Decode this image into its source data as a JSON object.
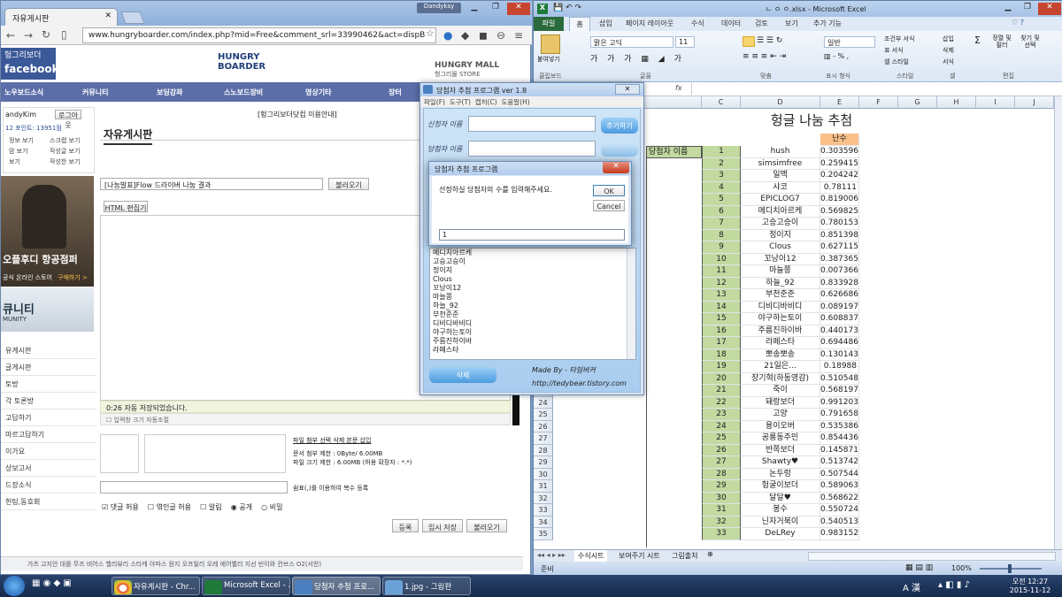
{
  "chrome": {
    "tab_title": "자유게시판",
    "user_badge": "Dandyksy",
    "url": "www.hungryboarder.com/index.php?mid=Free&comment_srl=33990462&act=dispB",
    "logo_fb_line1": "헝그리보더",
    "logo_fb_line2": "facebook",
    "hb_logo_line1": "HUNGRY",
    "hb_logo_line2": "BOARDER",
    "hm_logo_line1": "HUNGRY MALL",
    "hm_logo_line2": "헝그리몰 STORE",
    "nav": [
      "노우보드소식",
      "커뮤니티",
      "보딩강좌",
      "스노보드장비",
      "영상기타",
      "장터"
    ],
    "notice": "[헝그리보더닷컴 이용안내]",
    "board_title": "자유게시판",
    "user_name": "andyKim",
    "logout": "로그아웃",
    "points": "12  포인트: 13951점",
    "user_links": [
      "정보 보기",
      "스크랩 보기",
      "암 보기",
      "작성글 보기",
      "보기",
      "작성한 보기"
    ],
    "banner_text": "오플후디 항공점퍼",
    "banner_sub": "공식 온라인 스토어",
    "banner_btn": "구매하기 >",
    "banner2_title": "큐니티",
    "banner2_sub": "MUNITY",
    "left_menu": [
      "유게시판",
      "글게시판",
      "토방",
      "각 토론방",
      "고답하기",
      "마르고답하기",
      "이가요",
      "상보고서",
      "드장소식",
      "헌팅,동호회"
    ],
    "post_title_value": "[나눔발표]Flow 드라이버 나눔 결과",
    "load_btn": "불러오기",
    "html_edit": "HTML 편집기",
    "autosave": "0:26 자동 저장되었습니다.",
    "resize_label": "입력창 크기 자동조절",
    "attach_links": "파일 첨부  선택 삭제  본문 삽입",
    "attach_info1": "문서 첨부 제한 : 0Byte/ 6.00MB",
    "attach_info2": "파일 크기 제한 : 6.00MB (허용 확장자 : *.*)",
    "tag_hint": "쉼표(,)를 이용하여 복수 등록",
    "opt_comment": "댓글 허용",
    "opt_trackback": "엮인글 허용",
    "opt_alarm": "알림",
    "opt_public": "공개",
    "opt_secret": "비밀",
    "btn_register": "등록",
    "btn_tempsave": "임시 저장",
    "btn_load": "불러오기",
    "bottom_strip": "가츠  고지안  대를  무즈  비어스  헬리뷰리  스타캐  야파스  원지  오프빌리  오레  에어벨리  지선  빈이와  컨브스  O2(서찬)"
  },
  "excel": {
    "title": "ㄴ ㅇ ㅇ.xlsx - Microsoft Excel",
    "tabs": [
      "파일",
      "홈",
      "삽입",
      "페이지 레이아웃",
      "수식",
      "데이터",
      "검토",
      "보기",
      "추가 기능"
    ],
    "ribbon": {
      "paste": "붙여넣기",
      "clipboard": "클립보드",
      "font_name": "맑은 고딕",
      "font_size": "11",
      "font_group": "글꼴",
      "align_group": "맞춤",
      "number_format": "일반",
      "number_group": "표시 형식",
      "style_items": [
        "조건부 서식",
        "표 서식",
        "셀 스타일"
      ],
      "style_group": "스타일",
      "cell_items": [
        "삽입",
        "삭제",
        "서식"
      ],
      "cell_group": "셀",
      "edit_items": [
        "정렬 및 필터",
        "찾기 및 선택"
      ],
      "edit_group": "편집"
    },
    "fx": "fx",
    "columns": [
      "B",
      "C",
      "D",
      "E",
      "F",
      "G",
      "H",
      "I",
      "J"
    ],
    "sheet_title": "헝글 나눔 추첨",
    "header_label": "당첨자 이름",
    "rand_header": "난수",
    "rows": [
      {
        "r": "",
        "n": "1",
        "name": "hush",
        "v": "0.303596"
      },
      {
        "r": "",
        "n": "2",
        "name": "simsimfree",
        "v": "0.259415"
      },
      {
        "r": "",
        "n": "3",
        "name": "일맥",
        "v": "0.204242"
      },
      {
        "r": "",
        "n": "4",
        "name": "샤코",
        "v": "0.78111"
      },
      {
        "r": "",
        "n": "5",
        "name": "EPICLOG7",
        "v": "0.819006"
      },
      {
        "r": "",
        "n": "6",
        "name": "메디치아르케",
        "v": "0.569825"
      },
      {
        "r": "",
        "n": "7",
        "name": "고승고승이",
        "v": "0.780153"
      },
      {
        "r": "",
        "n": "8",
        "name": "정이지",
        "v": "0.851398"
      },
      {
        "r": "",
        "n": "9",
        "name": "Clous",
        "v": "0.627115"
      },
      {
        "r": "",
        "n": "10",
        "name": "꼬낭이12",
        "v": "0.387365"
      },
      {
        "r": "",
        "n": "11",
        "name": "마늘쫑",
        "v": "0.007366"
      },
      {
        "r": "",
        "n": "12",
        "name": "하늘_92",
        "v": "0.833928"
      },
      {
        "r": "",
        "n": "13",
        "name": "부천준준",
        "v": "0.626686"
      },
      {
        "r": "",
        "n": "14",
        "name": "디비디바비디",
        "v": "0.089197"
      },
      {
        "r": "",
        "n": "15",
        "name": "야구하는토이",
        "v": "0.608837"
      },
      {
        "r": "",
        "n": "16",
        "name": "주름진하이바",
        "v": "0.440173"
      },
      {
        "r": "",
        "n": "17",
        "name": "라페스타",
        "v": "0.694486"
      },
      {
        "r": "",
        "n": "18",
        "name": "뽀송뽀송",
        "v": "0.130143"
      },
      {
        "r": "",
        "n": "19",
        "name": "21일은...",
        "v": "0.18988"
      },
      {
        "r": "",
        "n": "20",
        "name": "장기혁(하동영감)",
        "v": "0.510548"
      },
      {
        "r": "23",
        "n": "21",
        "name": "죽이",
        "v": "0.568197"
      },
      {
        "r": "24",
        "n": "22",
        "name": "돼랑보더",
        "v": "0.991203"
      },
      {
        "r": "25",
        "n": "23",
        "name": "고양",
        "v": "0.791658"
      },
      {
        "r": "26",
        "n": "24",
        "name": "용이오버",
        "v": "0.535386"
      },
      {
        "r": "27",
        "n": "25",
        "name": "공룡동주민",
        "v": "0.854436"
      },
      {
        "r": "28",
        "n": "26",
        "name": "반쪽보더",
        "v": "0.145871"
      },
      {
        "r": "29",
        "n": "27",
        "name": "Shawty♥",
        "v": "0.513742"
      },
      {
        "r": "30",
        "n": "28",
        "name": "논두렁",
        "v": "0.507544"
      },
      {
        "r": "31",
        "n": "29",
        "name": "헝굴이보더",
        "v": "0.589063"
      },
      {
        "r": "32",
        "n": "30",
        "name": "달달♥",
        "v": "0.568622"
      },
      {
        "r": "33",
        "n": "31",
        "name": "봉수",
        "v": "0.550724"
      },
      {
        "r": "34",
        "n": "32",
        "name": "닌자거북이",
        "v": "0.540513"
      },
      {
        "r": "35",
        "n": "33",
        "name": "DeLRey",
        "v": "0.983152"
      }
    ],
    "sheets": [
      "수식시트",
      "보여주기 시트",
      "그림출처"
    ],
    "status_ready": "준비",
    "zoom": "100%"
  },
  "app": {
    "title": "당첨자 추첨 프로그램 ver 1.8",
    "menu": [
      "파일(F)",
      "도구(T)",
      "캡처(C)",
      "도움말(H)"
    ],
    "label1": "신청자 이름",
    "label2": "당첨자 이름",
    "add_btn": "추가하기",
    "list": [
      "메디치아르케",
      "고승고승이",
      "정이지",
      "Clous",
      "꼬낭이12",
      "마늘쫑",
      "하늘_92",
      "부천준준",
      "디비디바비디",
      "야구하는토이",
      "주름진하이바",
      "라페스타"
    ],
    "delete_btn": "삭제",
    "made_by": "Made By - 타임버커",
    "blog": "http://tedybear.tistory.com"
  },
  "dialog": {
    "title": "당첨자 추첨 프로그램",
    "prompt": "선정하실 당첨자의 수를 입력해주세요.",
    "ok": "OK",
    "cancel": "Cancel",
    "input_value": "1"
  },
  "taskbar": {
    "items": [
      "자유게시판 - Chr...",
      "Microsoft Excel - ...",
      "당첨자 추첨 프로...",
      "1.jpg - 그림판"
    ],
    "ime": "A 漢",
    "time": "오전 12:27",
    "date": "2015-11-12"
  }
}
